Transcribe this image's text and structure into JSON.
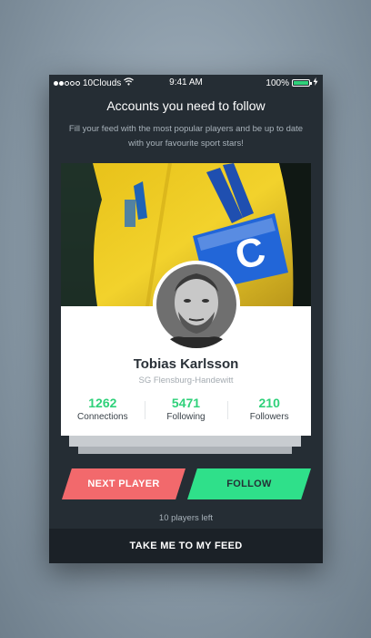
{
  "status_bar": {
    "carrier": "10Clouds",
    "time": "9:41 AM",
    "battery": "100%"
  },
  "header": {
    "title": "Accounts you need to follow",
    "subtitle": "Fill your feed with the most popular players and be up to date with your favourite sport stars!"
  },
  "player": {
    "name": "Tobias Karlsson",
    "club": "SG Flensburg-Handewitt",
    "stats": [
      {
        "value": "1262",
        "label": "Connections"
      },
      {
        "value": "5471",
        "label": "Following"
      },
      {
        "value": "210",
        "label": "Followers"
      }
    ]
  },
  "actions": {
    "next_label": "NEXT PLAYER",
    "follow_label": "FOLLOW",
    "players_left": "10 players left",
    "feed_label": "TAKE ME TO MY FEED"
  },
  "colors": {
    "accent_green": "#2fd17a",
    "next_red": "#f2696c",
    "screen_bg": "#252d34"
  },
  "icons": [
    "signal-dots-icon",
    "wifi-icon",
    "battery-icon",
    "charging-bolt-icon"
  ]
}
